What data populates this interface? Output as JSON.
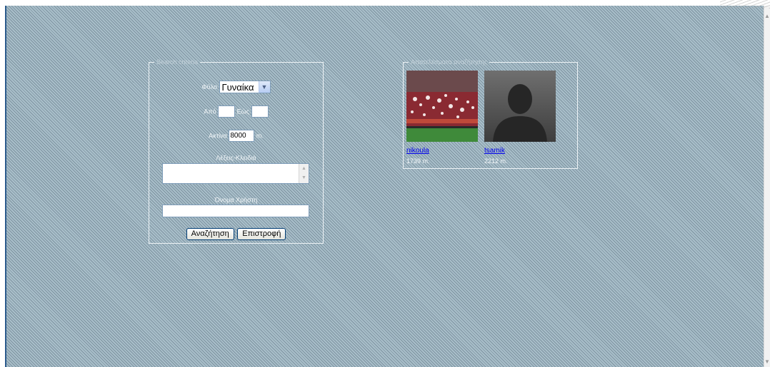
{
  "search_form": {
    "legend": "Search criteria",
    "gender": {
      "label": "Φύλο",
      "selected": "Γυναίκα"
    },
    "age": {
      "from_label": "Από",
      "from_value": "",
      "to_label": "Εώς",
      "to_value": ""
    },
    "radius": {
      "label": "Ακτίνα",
      "value": "8000",
      "unit": "m."
    },
    "keywords": {
      "label": "Λέξεις-Κλειδιά",
      "value": ""
    },
    "username": {
      "label": "Όνομα Χρήστη",
      "value": ""
    },
    "buttons": {
      "search": "Αναζήτηση",
      "back": "Επιστροφή"
    }
  },
  "results": {
    "legend": "Αποτελέσματα αναζήτησης",
    "users": [
      {
        "name": "nikoula",
        "distance": "1739 m.",
        "photo": "stadium-flares-photo"
      },
      {
        "name": "tsamik",
        "distance": "2212 m.",
        "photo": "default-silhouette-avatar"
      }
    ]
  }
}
